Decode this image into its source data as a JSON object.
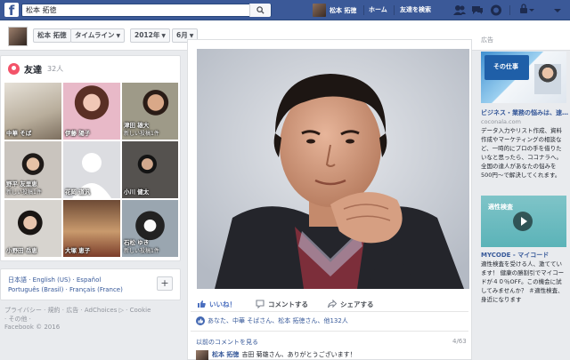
{
  "topbar": {
    "logo": "f",
    "search_value": "松本 拓徳",
    "user_name": "松本 拓徳",
    "home_label": "ホーム",
    "find_friends_label": "友達を検索"
  },
  "subbar": {
    "name": "松本 拓徳",
    "timeline_label": "タイムライン",
    "year": "2012年",
    "month": "6月"
  },
  "friends": {
    "title": "友達",
    "count": "32人",
    "items": [
      {
        "name": "中華 そば",
        "sub": ""
      },
      {
        "name": "伊藤 陽子",
        "sub": ""
      },
      {
        "name": "津田 雄大",
        "sub": "新しい投稿1件"
      },
      {
        "name": "野平 友里恵",
        "sub": "新しい投稿1件"
      },
      {
        "name": "花岡 道汎",
        "sub": ""
      },
      {
        "name": "小川 健太",
        "sub": ""
      },
      {
        "name": "小野田 岳恵",
        "sub": ""
      },
      {
        "name": "大塚 恵子",
        "sub": ""
      },
      {
        "name": "石松 ゆき",
        "sub": "新しい投稿1件"
      }
    ]
  },
  "languages": {
    "line1": "日本語 · English (US) · Español",
    "line2": "Português (Brasil) · Français (France)",
    "add_label": "+"
  },
  "footer": {
    "line1": "プライバシー · 規約 · 広告 · AdChoices ▷ · Cookie",
    "line2": "· その他 ·",
    "line3": "Facebook © 2016"
  },
  "post": {
    "actions": [
      {
        "label": "いいね！",
        "icon": "thumbs-up-icon"
      },
      {
        "label": "コメントする",
        "icon": "comment-icon"
      },
      {
        "label": "シェアする",
        "icon": "share-icon"
      }
    ],
    "likes_text": "あなた、中華 そばさん、松本 拓徳さん、他132人",
    "prev_comments": "以前のコメントを見る",
    "comment_count": "4/63",
    "comment_author": "松本 拓徳",
    "comment_text": "吉田 菊雄さん、ありがとうございます！"
  },
  "ads": {
    "label": "広告",
    "ad1": {
      "image_text": "その仕事",
      "title": "ビジネス・業務の悩みは、速…",
      "domain": "coconala.com",
      "body": "データ入力やリスト作成、資料作成やマーケティングの相談など、一時的にプロの手を借りたいなと思ったら、ココナラへ。全国の達人があなたの悩みを500円〜で解決してくれます。"
    },
    "ad2": {
      "image_text": "適性検査",
      "title": "MYCODE - マイコード",
      "body": "適性検査を受ける人、激てています！ 健康の勝割引でマイコードが４０％OFF。この機会に試してみませんか？ ＃適性検査、身近になります"
    }
  },
  "colors": {
    "brand": "#3b5998",
    "link": "#365899",
    "friends_icon": "#f35369"
  }
}
